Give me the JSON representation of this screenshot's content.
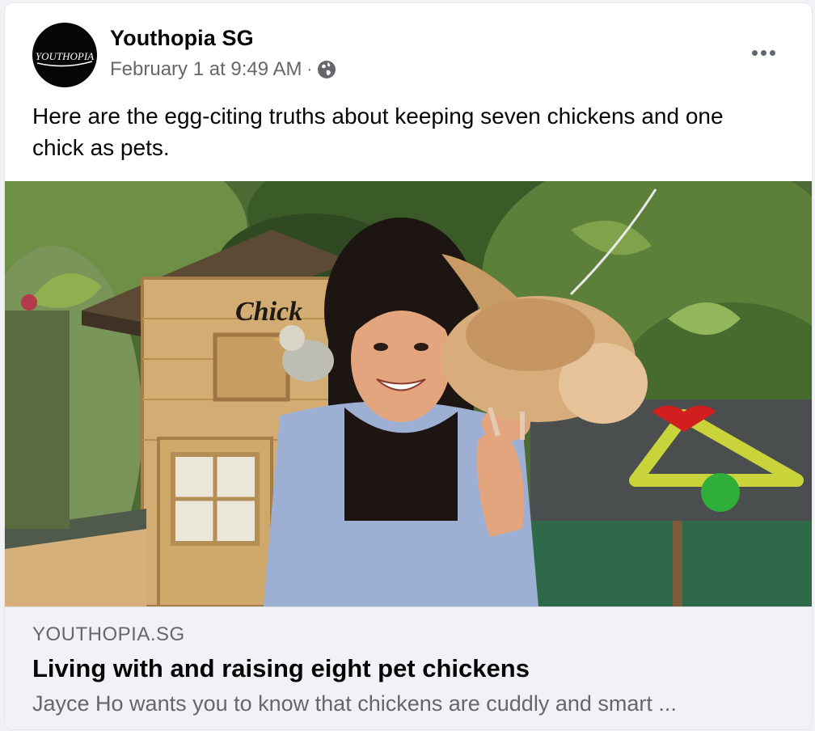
{
  "post": {
    "page_name": "Youthopia SG",
    "avatar_text": "YOUTHOPIA",
    "timestamp": "February 1 at 9:49 AM",
    "separator": "·",
    "audience_icon": "globe-icon",
    "more_icon": "more-options-icon",
    "text": "Here are the egg-citing truths about keeping seven chickens and one chick as pets."
  },
  "photo": {
    "coop_sign": "Chick"
  },
  "link_preview": {
    "domain": "YOUTHOPIA.SG",
    "title": "Living with and raising eight pet chickens",
    "description": "Jayce Ho wants you to know that chickens are cuddly and smart ..."
  },
  "colors": {
    "primary_text": "#050505",
    "secondary_text": "#65676b",
    "card_background": "#f0f2f5"
  }
}
